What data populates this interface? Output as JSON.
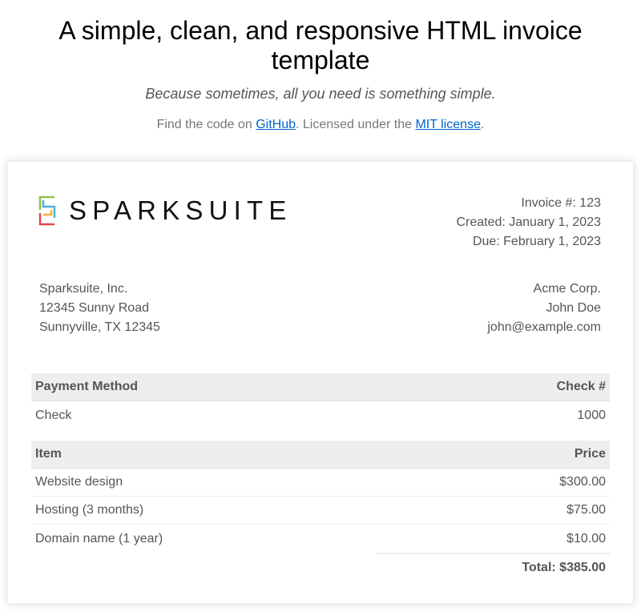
{
  "hero": {
    "title": "A simple, clean, and responsive HTML invoice template",
    "tagline": "Because sometimes, all you need is something simple.",
    "find_prefix": "Find the code on ",
    "github_link": "GitHub",
    "find_middle": ". Licensed under the ",
    "license_link": "MIT license",
    "find_suffix": "."
  },
  "invoice": {
    "logo_text": "SPARKSUITE",
    "logo_colors": [
      "#8bc34a",
      "#4fb3d9",
      "#f2b233",
      "#e0454f"
    ],
    "number_line": "Invoice #: 123",
    "created_line": "Created: January 1, 2023",
    "due_line": "Due: February 1, 2023",
    "from": {
      "company": "Sparksuite, Inc.",
      "street": "12345 Sunny Road",
      "city": "Sunnyville, TX 12345"
    },
    "to": {
      "company": "Acme Corp.",
      "name": "John Doe",
      "email": "john@example.com"
    },
    "payment": {
      "header_left": "Payment Method",
      "header_right": "Check #",
      "method": "Check",
      "value": "1000"
    },
    "items_header": {
      "left": "Item",
      "right": "Price"
    },
    "items": [
      {
        "name": "Website design",
        "price": "$300.00"
      },
      {
        "name": "Hosting (3 months)",
        "price": "$75.00"
      },
      {
        "name": "Domain name (1 year)",
        "price": "$10.00"
      }
    ],
    "total": "Total: $385.00"
  }
}
